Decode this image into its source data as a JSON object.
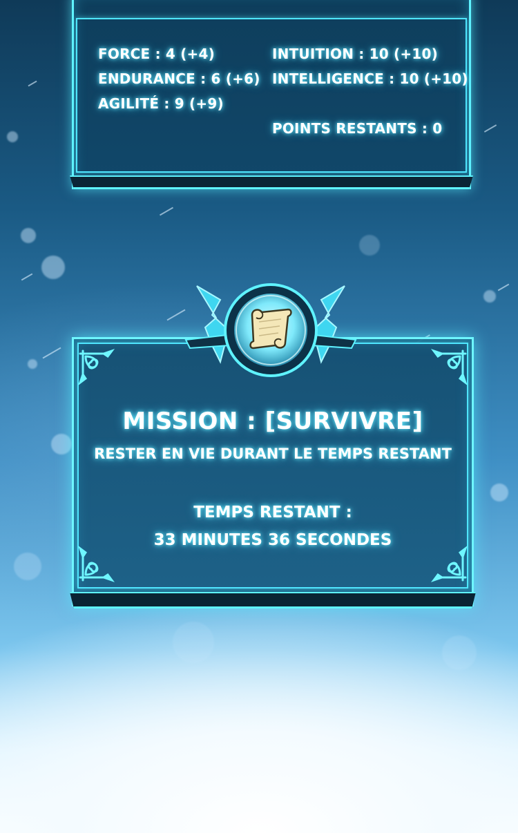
{
  "stats_panel": {
    "stats": [
      {
        "label": "FORCE : 4 (+4)"
      },
      {
        "label": "ENDURANCE : 6 (+6)"
      },
      {
        "label": "AGILITÉ : 9 (+9)"
      },
      {
        "label": "INTUITION : 10 (+10)"
      },
      {
        "label": "INTELLIGENCE : 10 (+10)"
      }
    ],
    "remaining_points": "POINTS RESTANTS : 0"
  },
  "mission_panel": {
    "icon": "scroll-icon",
    "title": "MISSION : [SURVIVRE]",
    "description": "RESTER EN VIE DURANT LE TEMPS RESTANT",
    "time_label": "TEMPS RESTANT :",
    "time_value": "33 MINUTES 36 SECONDES"
  },
  "colors": {
    "glow": "#5ff3ff",
    "panel": "#14506f",
    "text": "#ffffff"
  }
}
